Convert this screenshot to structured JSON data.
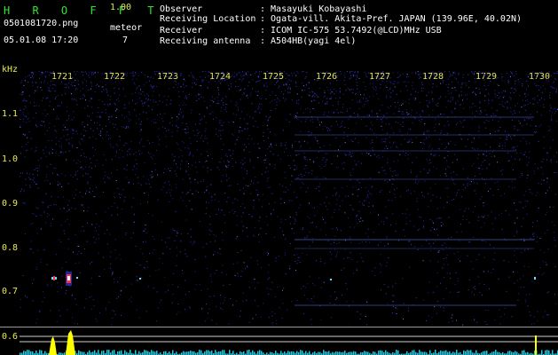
{
  "header": {
    "brand": "H R O F F T",
    "version": "1.00",
    "filename": "0501081720.png",
    "datetime": "05.01.08 17:20",
    "meteor_label": "meteor",
    "meteor_count": "7"
  },
  "info": {
    "observer_label": "Observer",
    "observer_value": ": Masayuki Kobayashi",
    "location_label": "Receiving Location",
    "location_value": ": Ogata-vill. Akita-Pref. JAPAN (139.96E, 40.02N)",
    "receiver_label": "Receiver",
    "receiver_value": ": ICOM IC-575 53.7492(@LCD)MHz USB",
    "antenna_label": "Receiving antenna",
    "antenna_value": ": A504HB(yagi 4el)"
  },
  "axis": {
    "y_unit": "kHz",
    "x_ticks": [
      "1721",
      "1722",
      "1723",
      "1724",
      "1725",
      "1726",
      "1727",
      "1728",
      "1729",
      "1730"
    ],
    "y_ticks": [
      "1.1",
      "1.0",
      "0.9",
      "0.8",
      "0.7"
    ],
    "bottom_tick": "0.6"
  },
  "colors": {
    "background": "#000000",
    "noise": "#2a2aa0",
    "brand": "#2ee62e",
    "tick": "#e8e85a",
    "signal_peak": "#ff3040",
    "bottom_spike": "#ffff00",
    "bottom_noise": "#20c8e0"
  }
}
